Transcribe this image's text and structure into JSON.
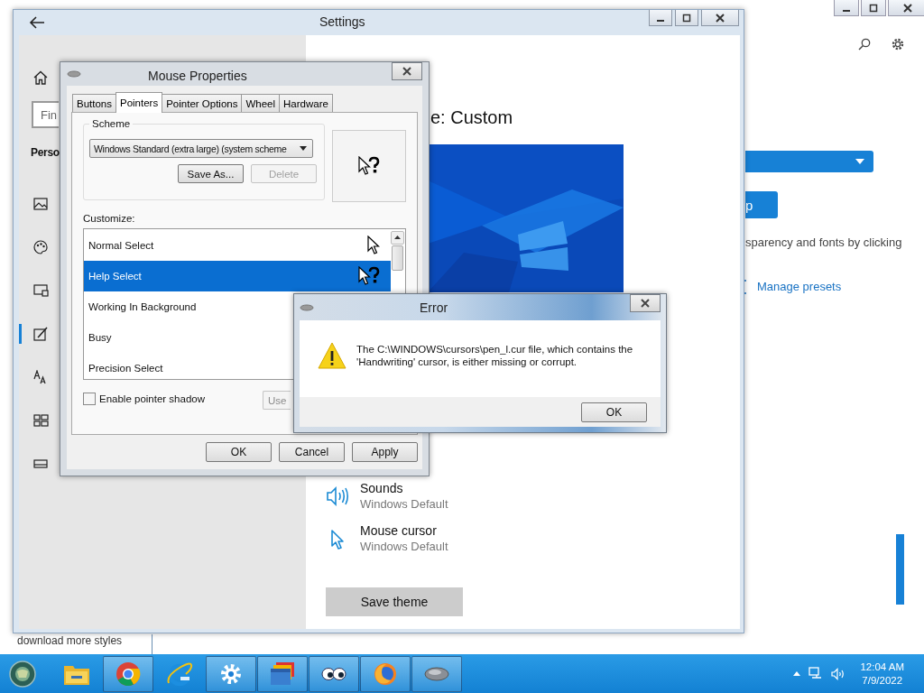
{
  "background_window": {
    "button": "p",
    "description": "sparency and fonts by clicking",
    "link": "Manage presets",
    "footer_link": "download more styles"
  },
  "settings": {
    "title": "Settings",
    "search": {
      "placeholder": "Fin"
    },
    "section": "Perso",
    "nav": [
      {
        "kind": "picture",
        "selected": false
      },
      {
        "kind": "palette",
        "selected": false
      },
      {
        "kind": "lockscreen",
        "selected": false
      },
      {
        "kind": "themes",
        "selected": true
      },
      {
        "kind": "fonts",
        "selected": false
      },
      {
        "kind": "start",
        "selected": false
      },
      {
        "kind": "taskbar",
        "selected": false
      }
    ],
    "heading": "e: Custom",
    "items": [
      {
        "kind": "sound",
        "title": "Sounds",
        "value": "Windows Default"
      },
      {
        "kind": "cursor",
        "title": "Mouse cursor",
        "value": "Windows Default"
      }
    ],
    "save_button": "Save theme"
  },
  "mouse_properties": {
    "title": "Mouse Properties",
    "tabs": [
      {
        "label": "Buttons",
        "selected": false
      },
      {
        "label": "Pointers",
        "selected": true
      },
      {
        "label": "Pointer Options",
        "selected": false
      },
      {
        "label": "Wheel",
        "selected": false
      },
      {
        "label": "Hardware",
        "selected": false
      }
    ],
    "scheme": {
      "label": "Scheme",
      "value": "Windows Standard (extra large) (system scheme",
      "buttons": [
        {
          "label": "Save As...",
          "disabled": false
        },
        {
          "label": "Delete",
          "disabled": true
        }
      ]
    },
    "customize_label": "Customize:",
    "cursors": [
      {
        "name": "Normal Select",
        "selected": false,
        "kind": "arrow"
      },
      {
        "name": "Help Select",
        "selected": true,
        "kind": "help"
      },
      {
        "name": "Working In Background",
        "selected": false
      },
      {
        "name": "Busy",
        "selected": false
      },
      {
        "name": "Precision Select",
        "selected": false
      }
    ],
    "pointer_shadow": {
      "label": "Enable pointer shadow",
      "checked": false
    },
    "use_default": {
      "label": "Use",
      "disabled": true
    },
    "buttons": [
      "OK",
      "Cancel",
      "Apply"
    ]
  },
  "error": {
    "title": "Error",
    "message": "The C:\\WINDOWS\\cursors\\pen_l.cur file, which contains the 'Handwriting' cursor, is either missing or corrupt.",
    "button": "OK"
  },
  "taskbar": {
    "apps": [
      {
        "kind": "folder",
        "active": false
      },
      {
        "kind": "chrome",
        "active": true
      },
      {
        "kind": "ie",
        "active": false
      },
      {
        "kind": "gear",
        "active": true
      },
      {
        "kind": "windows",
        "active": true
      },
      {
        "kind": "eyes",
        "active": true
      },
      {
        "kind": "firefox",
        "active": true
      },
      {
        "kind": "mouse",
        "active": true
      }
    ],
    "time": "12:04 AM",
    "date": "7/9/2022"
  }
}
